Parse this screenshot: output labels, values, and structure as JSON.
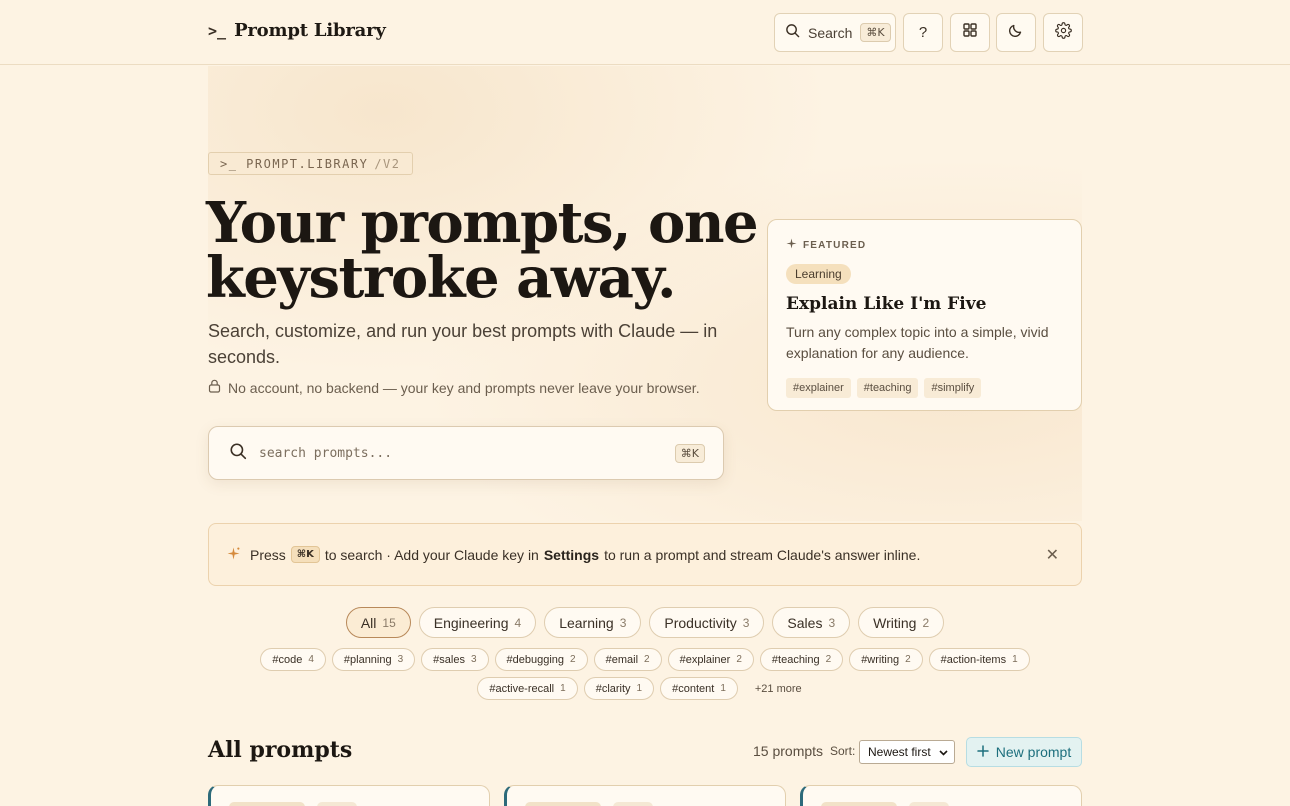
{
  "header": {
    "brand_glyph": ">_",
    "brand_name": "Prompt Library",
    "search_label": "Search",
    "search_shortcut": "⌘K",
    "help_label": "?"
  },
  "hero": {
    "tagline_main": ">_ PROMPT.LIBRARY",
    "tagline_version": "/V2",
    "headline": "Your prompts, one keystroke away.",
    "subhead": "Search, customize, and run your best prompts with Claude — in seconds.",
    "privacy_note": "No account, no backend — your key and prompts never leave your browser.",
    "search_placeholder": "search prompts...",
    "search_shortcut": "⌘K"
  },
  "featured": {
    "label": "FEATURED",
    "category": "Learning",
    "title": "Explain Like I'm Five",
    "description": "Turn any complex topic into a simple, vivid explanation for any audience.",
    "tags": [
      "#explainer",
      "#teaching",
      "#simplify"
    ]
  },
  "tip": {
    "press": "Press",
    "shortcut": "⌘K",
    "middle": "to search · Add your Claude key in",
    "settings": "Settings",
    "end": "to run a prompt and stream Claude's answer inline."
  },
  "categories": [
    {
      "label": "All",
      "count": "15",
      "active": true
    },
    {
      "label": "Engineering",
      "count": "4"
    },
    {
      "label": "Learning",
      "count": "3"
    },
    {
      "label": "Productivity",
      "count": "3"
    },
    {
      "label": "Sales",
      "count": "3"
    },
    {
      "label": "Writing",
      "count": "2"
    }
  ],
  "tags_row1": [
    {
      "label": "#code",
      "count": "4"
    },
    {
      "label": "#planning",
      "count": "3"
    },
    {
      "label": "#sales",
      "count": "3"
    },
    {
      "label": "#debugging",
      "count": "2"
    },
    {
      "label": "#email",
      "count": "2"
    },
    {
      "label": "#explainer",
      "count": "2"
    },
    {
      "label": "#teaching",
      "count": "2"
    },
    {
      "label": "#writing",
      "count": "2"
    },
    {
      "label": "#action-items",
      "count": "1"
    }
  ],
  "tags_row2": [
    {
      "label": "#active-recall",
      "count": "1"
    },
    {
      "label": "#clarity",
      "count": "1"
    },
    {
      "label": "#content",
      "count": "1"
    }
  ],
  "more_tags": "+21 more",
  "list": {
    "title": "All prompts",
    "count": "15 prompts",
    "sort_label": "Sort:",
    "sort_value": "Newest first",
    "new_button": "New prompt"
  },
  "colors": {
    "background": "#fdf3e3",
    "accent_teal": "#1d6f7d",
    "tip_spark": "#d58a3c"
  }
}
